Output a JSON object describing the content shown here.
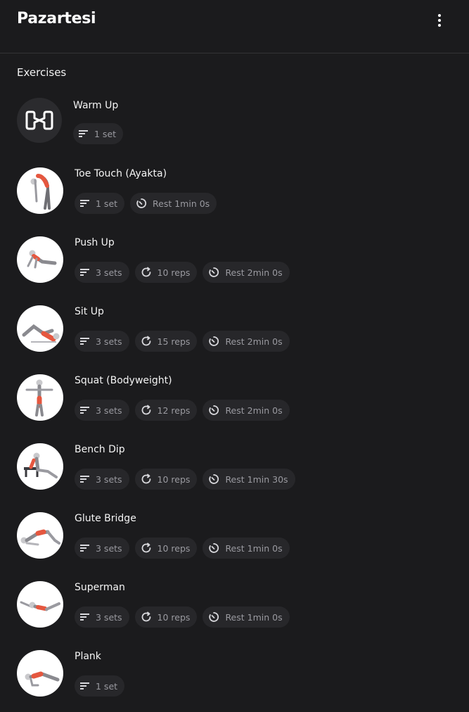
{
  "header": {
    "title": "Pazartesi",
    "menu_icon": "more-vert-icon"
  },
  "section_label": "Exercises",
  "colors": {
    "background": "#1b1b1d",
    "chip_bg": "#27272a",
    "chip_text": "#9a9aa0",
    "muscle_highlight": "#e5573f"
  },
  "exercises": [
    {
      "name": "Warm Up",
      "icon": "warm-up-logo-icon",
      "sets": "1 set"
    },
    {
      "name": "Toe Touch (Ayakta)",
      "icon": "toe-touch-figure",
      "sets": "1 set",
      "rest": "Rest 1min 0s"
    },
    {
      "name": "Push Up",
      "icon": "push-up-figure",
      "sets": "3 sets",
      "reps": "10 reps",
      "rest": "Rest 2min 0s"
    },
    {
      "name": "Sit Up",
      "icon": "sit-up-figure",
      "sets": "3 sets",
      "reps": "15 reps",
      "rest": "Rest 2min 0s"
    },
    {
      "name": "Squat (Bodyweight)",
      "icon": "squat-figure",
      "sets": "3 sets",
      "reps": "12 reps",
      "rest": "Rest 2min 0s"
    },
    {
      "name": "Bench Dip",
      "icon": "bench-dip-figure",
      "sets": "3 sets",
      "reps": "10 reps",
      "rest": "Rest 1min 30s"
    },
    {
      "name": "Glute Bridge",
      "icon": "glute-bridge-figure",
      "sets": "3 sets",
      "reps": "10 reps",
      "rest": "Rest 1min 0s"
    },
    {
      "name": "Superman",
      "icon": "superman-figure",
      "sets": "3 sets",
      "reps": "10 reps",
      "rest": "Rest 1min 0s"
    },
    {
      "name": "Plank",
      "icon": "plank-figure",
      "sets": "1 set"
    }
  ]
}
